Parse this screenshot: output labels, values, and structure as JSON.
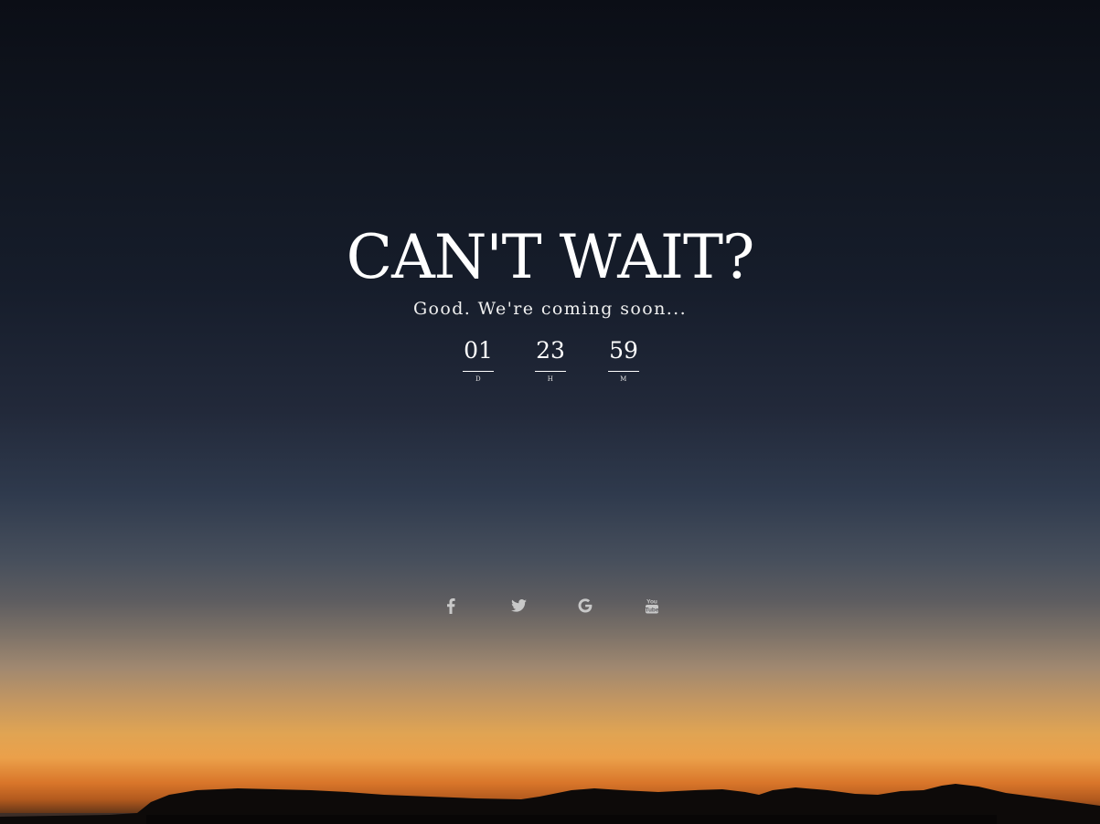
{
  "hero": {
    "title": "CAN'T WAIT?",
    "subtitle": "Good. We're coming soon..."
  },
  "countdown": [
    {
      "value": "01",
      "unit": "D"
    },
    {
      "value": "23",
      "unit": "H"
    },
    {
      "value": "59",
      "unit": "M"
    }
  ],
  "social": [
    {
      "name": "facebook",
      "icon": "facebook-icon"
    },
    {
      "name": "twitter",
      "icon": "twitter-icon"
    },
    {
      "name": "google",
      "icon": "google-icon"
    },
    {
      "name": "youtube",
      "icon": "youtube-icon"
    }
  ],
  "colors": {
    "text": "#ffffff",
    "icon": "#c8c8c8"
  }
}
